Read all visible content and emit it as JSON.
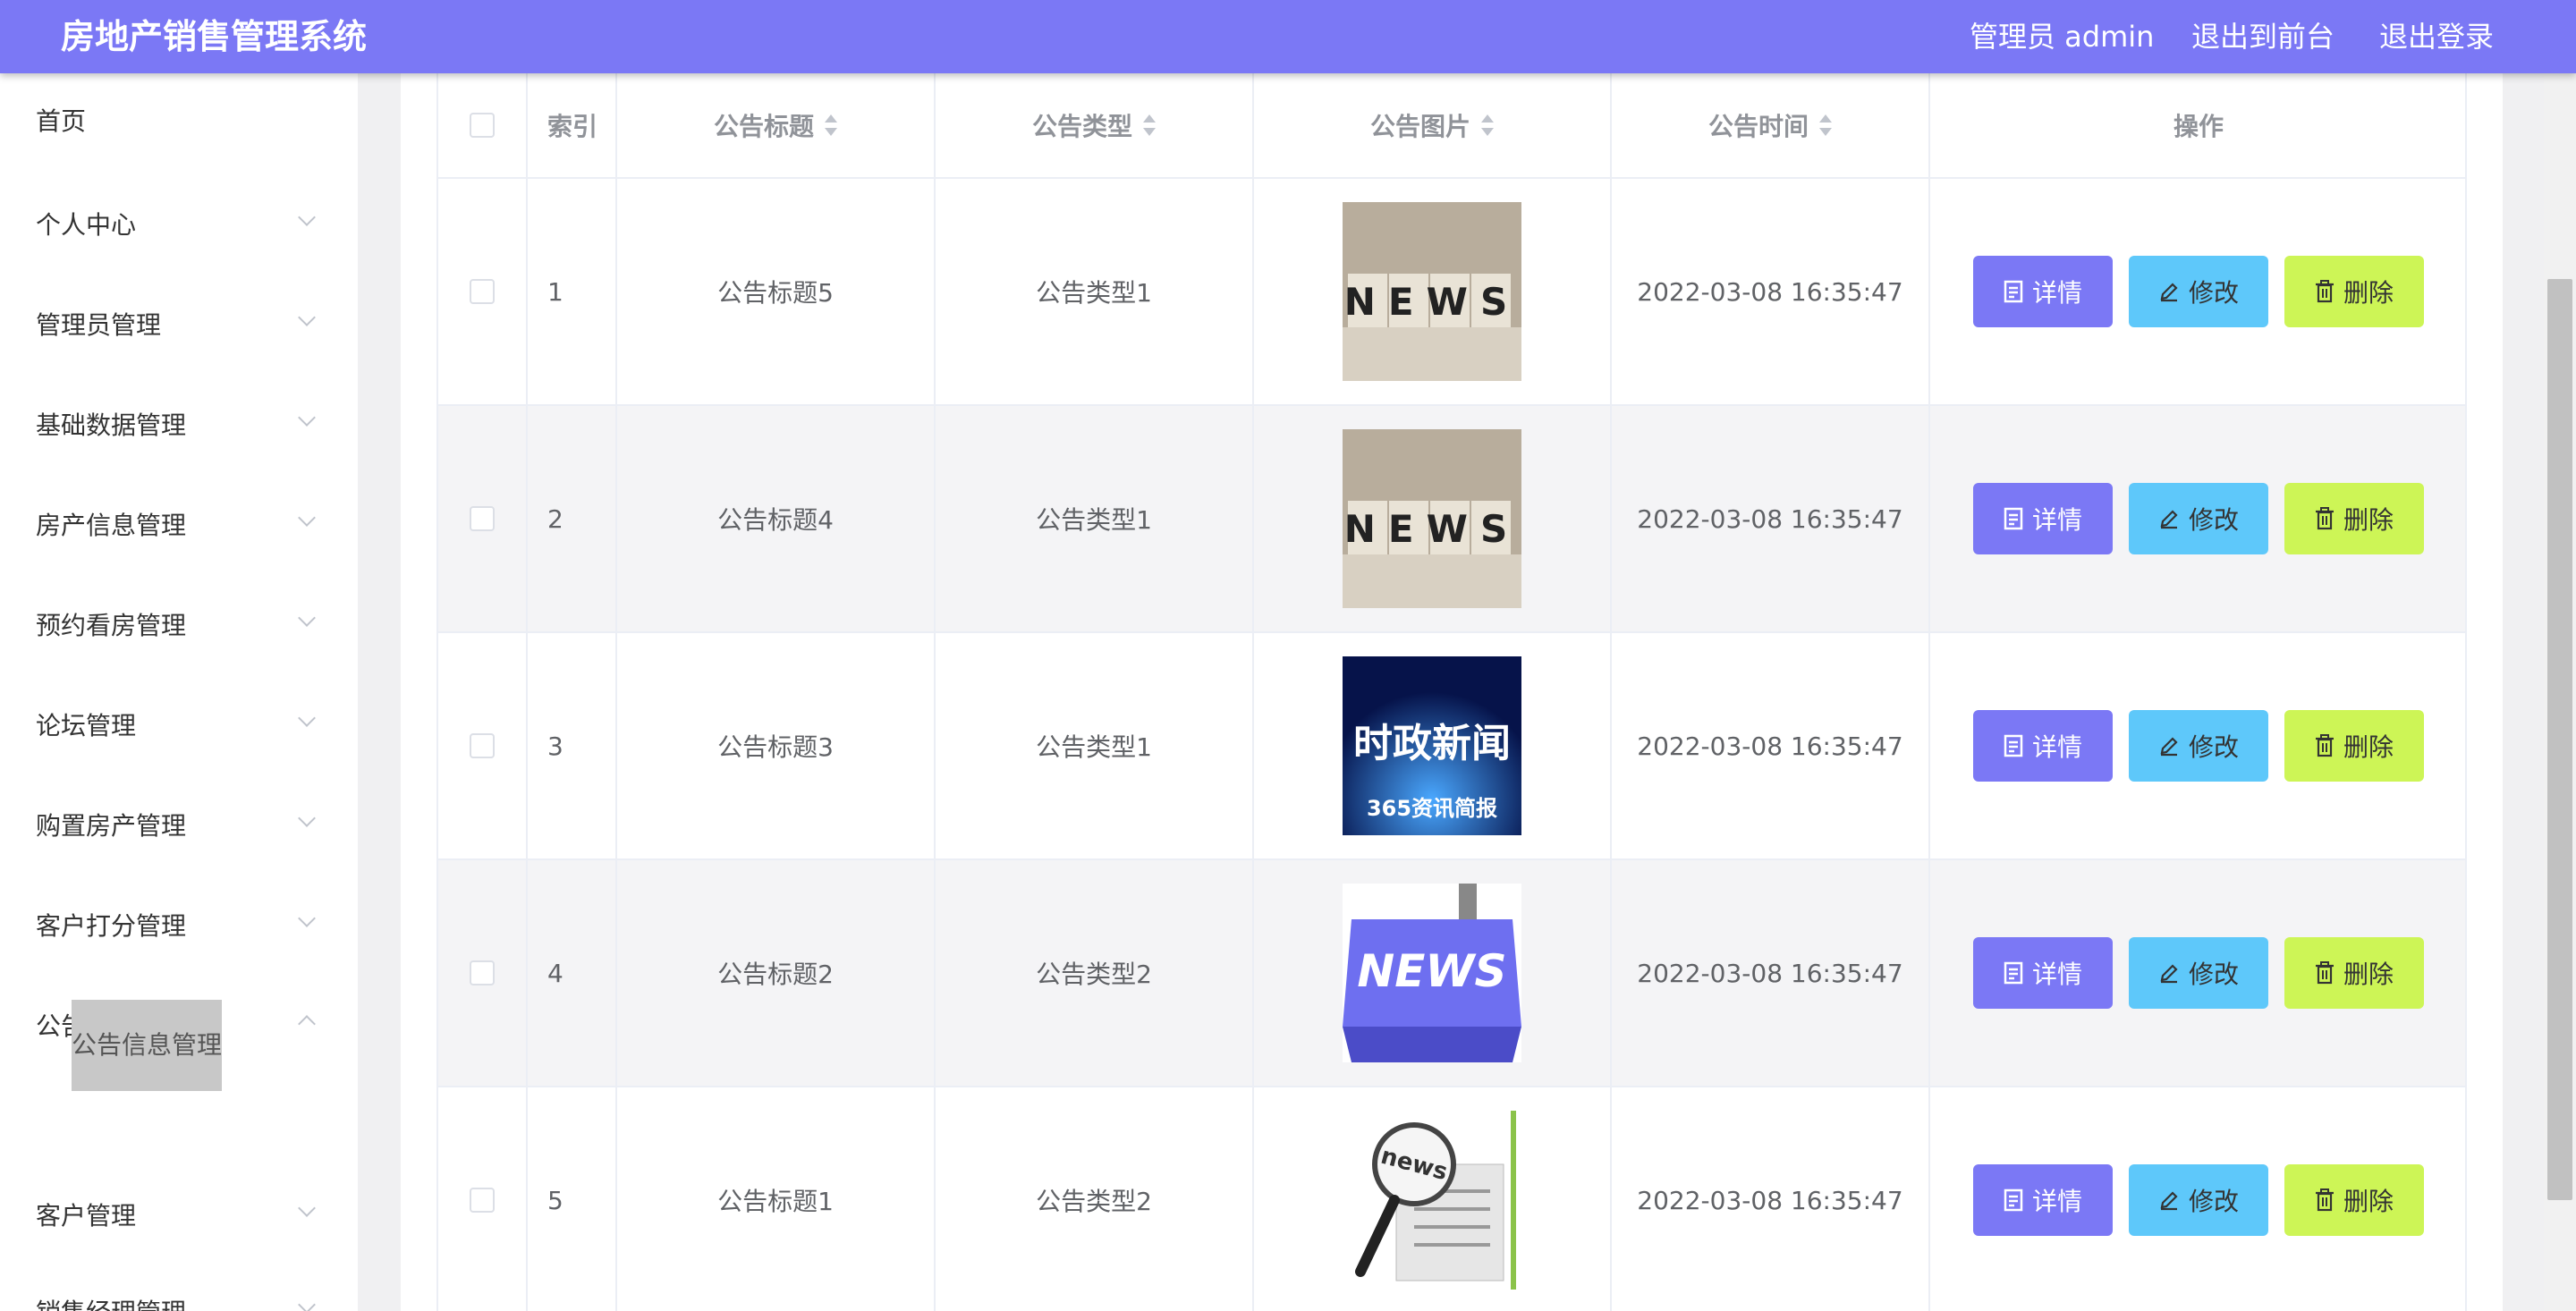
{
  "app": {
    "title": "房地产销售管理系统",
    "user_label": "管理员 admin",
    "to_front": "退出到前台",
    "logout": "退出登录"
  },
  "sidebar": {
    "items": [
      {
        "label": "首页",
        "expandable": false
      },
      {
        "label": "个人中心",
        "expandable": true
      },
      {
        "label": "管理员管理",
        "expandable": true
      },
      {
        "label": "基础数据管理",
        "expandable": true
      },
      {
        "label": "房产信息管理",
        "expandable": true
      },
      {
        "label": "预约看房管理",
        "expandable": true
      },
      {
        "label": "论坛管理",
        "expandable": true
      },
      {
        "label": "购置房产管理",
        "expandable": true
      },
      {
        "label": "客户打分管理",
        "expandable": true
      },
      {
        "label": "公告信息管理",
        "expandable": true,
        "expanded": true
      },
      {
        "label": "客户管理",
        "expandable": true
      },
      {
        "label": "销售经理管理",
        "expandable": true
      }
    ],
    "active_subitem": "公告信息管理"
  },
  "table": {
    "headers": {
      "index": "索引",
      "title": "公告标题",
      "type": "公告类型",
      "image": "公告图片",
      "time": "公告时间",
      "actions": "操作"
    },
    "rows": [
      {
        "index": "1",
        "title": "公告标题5",
        "type": "公告类型1",
        "image": "news-cubes-image",
        "time": "2022-03-08 16:35:47"
      },
      {
        "index": "2",
        "title": "公告标题4",
        "type": "公告类型1",
        "image": "news-cubes-image",
        "time": "2022-03-08 16:35:47"
      },
      {
        "index": "3",
        "title": "公告标题3",
        "type": "公告类型1",
        "image": "political-news-image",
        "time": "2022-03-08 16:35:47"
      },
      {
        "index": "4",
        "title": "公告标题2",
        "type": "公告类型2",
        "image": "news-key-image",
        "time": "2022-03-08 16:35:47"
      },
      {
        "index": "5",
        "title": "公告标题1",
        "type": "公告类型2",
        "image": "news-magnifier-image",
        "time": "2022-03-08 16:35:47"
      }
    ],
    "actions": {
      "detail": "详情",
      "edit": "修改",
      "delete": "删除"
    }
  },
  "thumbnails": {
    "news_word": "NEWS",
    "political_title": "时政新闻",
    "political_subtitle": "365资讯简报",
    "key_word": "NEWS",
    "paper_word": "news"
  },
  "colors": {
    "primary": "#7b78f5",
    "edit": "#5ec8fa",
    "delete": "#cdf556"
  }
}
